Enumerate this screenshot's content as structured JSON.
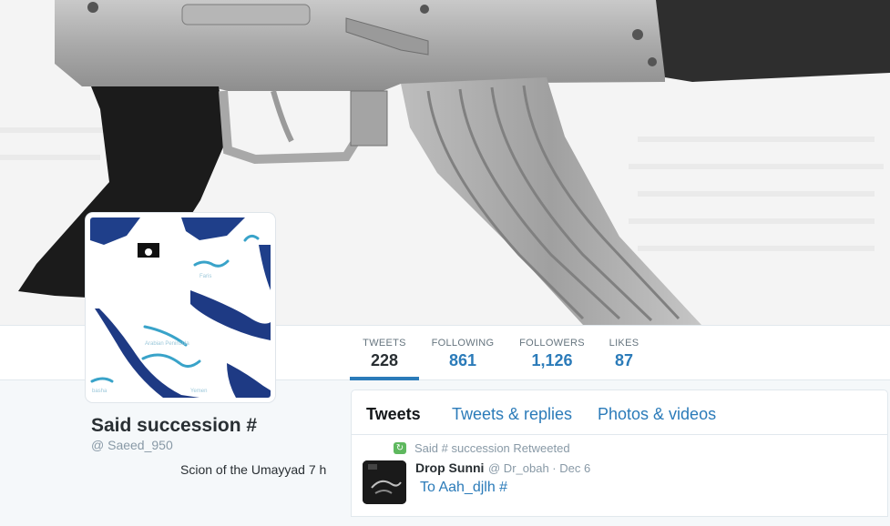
{
  "header": {
    "image": "ak-47-rifle-header-image"
  },
  "avatar": {
    "image": "arabian-peninsula-map-avatar"
  },
  "nav": {
    "stats": [
      {
        "label": "TWEETS",
        "value": "228",
        "active": true
      },
      {
        "label": "FOLLOWING",
        "value": "861",
        "active": false
      },
      {
        "label": "FOLLOWERS",
        "value": "1,126",
        "active": false
      },
      {
        "label": "LIKES",
        "value": "87",
        "active": false
      }
    ]
  },
  "profile": {
    "name": "Said succession #",
    "handle": "@ Saeed_950",
    "bio": "Scion of the Umayyad 7 h"
  },
  "timeline": {
    "tabs": [
      "Tweets",
      "Tweets & replies",
      "Photos & videos"
    ],
    "active_tab": "Tweets",
    "tweet": {
      "retweet_icon": "retweet-icon",
      "retweet_text": "Said # succession Retweeted",
      "author_name": "Drop Sunni",
      "author_meta": "@ Dr_obah · Dec 6",
      "text": "To Aah_djlh #"
    }
  },
  "colors": {
    "accent": "#2b7bb9",
    "muted": "#8899a6",
    "retweet": "#5eb85e"
  }
}
